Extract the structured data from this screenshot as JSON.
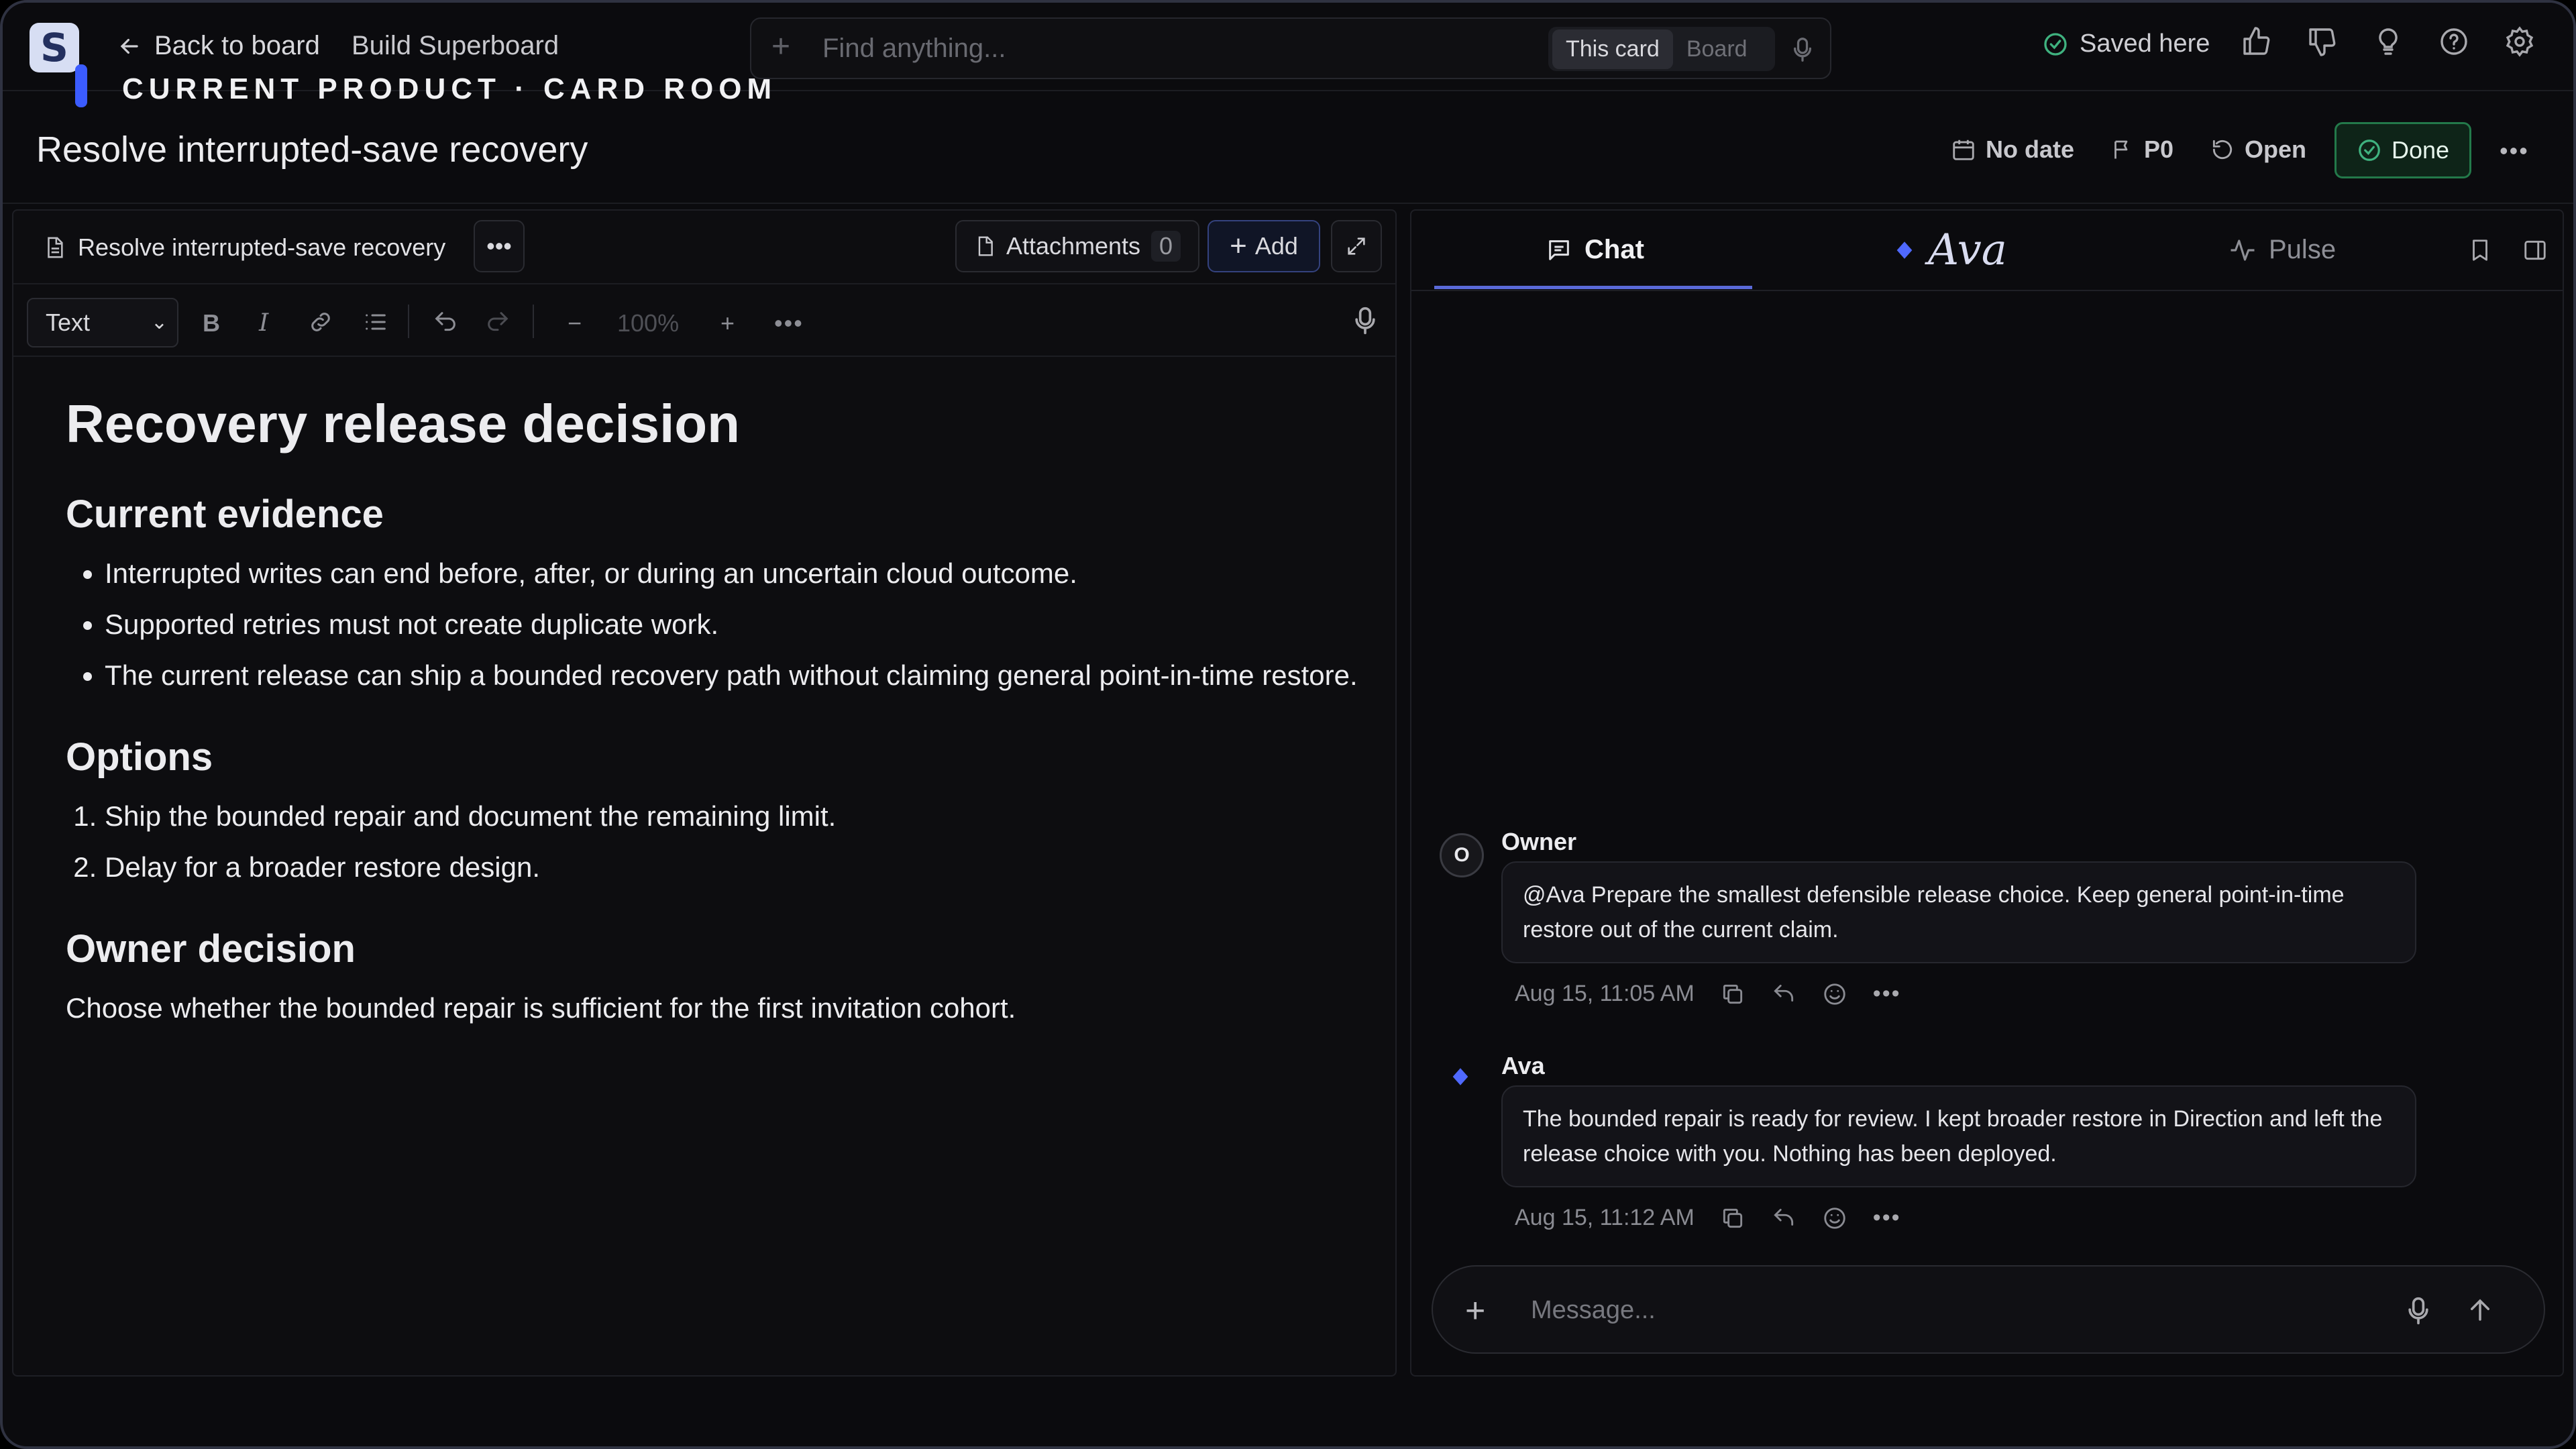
{
  "app": {
    "logo_letter": "S",
    "accent": "#3b5cff"
  },
  "nav": {
    "back_label": "Back to board",
    "board_name": "Build Superboard",
    "room_title": "CURRENT PRODUCT · CARD ROOM"
  },
  "search": {
    "placeholder": "Find anything...",
    "scope_options": [
      "This card",
      "Board"
    ],
    "scope_selected": "This card"
  },
  "status": {
    "saved": "Saved here"
  },
  "top_icons": [
    "thumbs-up-icon",
    "thumbs-down-icon",
    "lightbulb-icon",
    "help-icon",
    "settings-icon"
  ],
  "card": {
    "title": "Resolve interrupted-save recovery",
    "date": "No date",
    "priority": "P0",
    "state": "Open",
    "done_label": "Done",
    "done_color": "#23794a"
  },
  "editor": {
    "doc_tab": "Resolve interrupted-save recovery",
    "attachments_label": "Attachments",
    "attachments_count": "0",
    "add_label": "Add",
    "format_value": "Text",
    "zoom": "100%",
    "doc": {
      "h1": "Recovery release decision",
      "sections": [
        {
          "heading": "Current evidence",
          "items": [
            "Interrupted writes can end before, after, or during an uncertain cloud outcome.",
            "Supported retries must not create duplicate work.",
            "The current release can ship a bounded recovery path without claiming general point-in-time restore."
          ]
        },
        {
          "heading": "Options",
          "items": [
            "Ship the bounded repair and document the remaining limit.",
            "Delay for a broader restore design."
          ]
        },
        {
          "heading": "Owner decision",
          "text": "Choose whether the bounded repair is sufficient for the first invitation cohort."
        }
      ]
    }
  },
  "chat": {
    "tabs": [
      {
        "label": "Chat"
      },
      {
        "label": "Ava"
      },
      {
        "label": "Pulse"
      }
    ],
    "messages": [
      {
        "avatar": "O",
        "sender": "Owner",
        "text": "@Ava Prepare the smallest defensible release choice. Keep general point-in-time restore out of the current claim.",
        "time": "Aug 15, 11:05 AM"
      },
      {
        "sender": "Ava",
        "text": "The bounded repair is ready for review. I kept broader restore in Direction and left the release choice with you. Nothing has been deployed.",
        "time": "Aug 15, 11:12 AM"
      }
    ],
    "composer_placeholder": "Message..."
  }
}
